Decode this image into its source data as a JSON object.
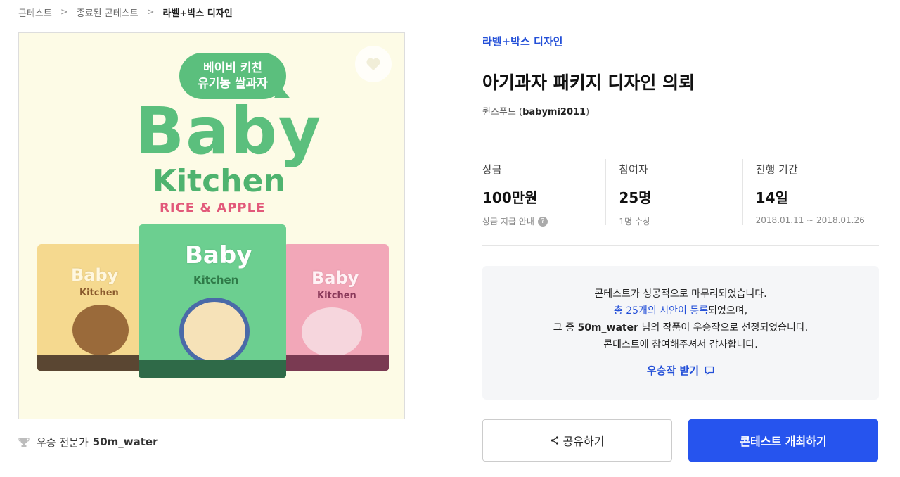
{
  "breadcrumb": {
    "items": [
      "콘테스트",
      "종료된 콘테스트",
      "라벨+박스 디자인"
    ]
  },
  "image": {
    "bubble_line1": "베이비 키친",
    "bubble_line2": "유기농 쌀과자",
    "brand_top": "Baby",
    "brand_bottom": "Kitchen",
    "flavor": "RICE & APPLE",
    "pouch_baby": "Baby",
    "pouch_kitchen": "Kitchen"
  },
  "winner": {
    "label": "우승 전문가",
    "name": "50m_water"
  },
  "contest": {
    "category": "라벨+박스 디자인",
    "title": "아기과자 패키지 디자인 의뢰",
    "host_name": "퀸즈푸드",
    "host_handle": "babymi2011"
  },
  "stats": {
    "prize": {
      "label": "상금",
      "value": "100만원",
      "sub": "상금 지급 안내"
    },
    "participants": {
      "label": "참여자",
      "value": "25명",
      "sub": "1명 수상"
    },
    "period": {
      "label": "진행 기간",
      "value": "14일",
      "sub": "2018.01.11 ~ 2018.01.26"
    }
  },
  "notice": {
    "line1": "콘테스트가 성공적으로 마무리되었습니다.",
    "line2_link": "총 25개의 시안이 등록",
    "line2_rest": "되었으며,",
    "line3_pre": "그 중",
    "line3_winner": "50m_water",
    "line3_rest": "님의 작품이 우승작으로 선정되었습니다.",
    "line4": "콘테스트에 참여해주셔서 감사합니다.",
    "cta": "우승작 받기"
  },
  "buttons": {
    "share": "공유하기",
    "host": "콘테스트 개최하기"
  },
  "colors": {
    "accent": "#2654ee",
    "link": "#2450d8",
    "brand_green": "#5bbf7d"
  }
}
